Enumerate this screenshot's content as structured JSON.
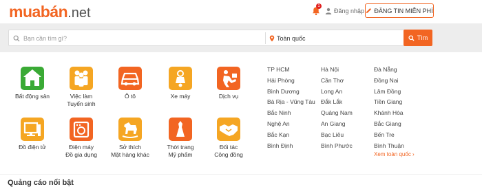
{
  "header": {
    "logo_main": "muabán",
    "logo_suffix": ".net",
    "notification_count": "1",
    "login_label": "Đăng nhập",
    "post_button_label": "ĐĂNG TIN MIỄN PHÍ"
  },
  "search": {
    "placeholder": "Bạn cần tìm gì?",
    "location": "Toàn quốc",
    "button_label": "Tìm"
  },
  "categories": [
    {
      "label": "Bất động sản",
      "icon": "house-icon",
      "color": "#3aaa35"
    },
    {
      "label": "Việc làm\nTuyển sinh",
      "icon": "people-icon",
      "color": "#f5a623"
    },
    {
      "label": "Ô tô",
      "icon": "car-icon",
      "color": "#f26522"
    },
    {
      "label": "Xe máy",
      "icon": "motorbike-icon",
      "color": "#f5a623"
    },
    {
      "label": "Dịch vụ",
      "icon": "service-icon",
      "color": "#f26522"
    },
    {
      "label": "Đồ điện tử",
      "icon": "computer-icon",
      "color": "#f5a623"
    },
    {
      "label": "Điện máy\nĐồ gia dụng",
      "icon": "appliance-icon",
      "color": "#f26522"
    },
    {
      "label": "Sở thích\nMặt hàng khác",
      "icon": "toy-horse-icon",
      "color": "#f5a623"
    },
    {
      "label": "Thời trang\nMỹ phẩm",
      "icon": "fashion-icon",
      "color": "#f26522"
    },
    {
      "label": "Đối tác\nCông đồng",
      "icon": "handshake-icon",
      "color": "#f5a623"
    }
  ],
  "cities": [
    [
      "TP HCM",
      "Hà Nội",
      "Đà Nẵng"
    ],
    [
      "Hải Phòng",
      "Cần Thơ",
      "Đồng Nai"
    ],
    [
      "Bình Dương",
      "Long An",
      "Lâm Đồng"
    ],
    [
      "Bà Rịa - Vũng Tàu",
      "Đắk Lắk",
      "Tiền Giang"
    ],
    [
      "Bắc Ninh",
      "Quảng Nam",
      "Khánh Hòa"
    ],
    [
      "Nghệ An",
      "An Giang",
      "Bắc Giang"
    ],
    [
      "Bắc Kạn",
      "Bạc Liêu",
      "Bến Tre"
    ],
    [
      "Bình Định",
      "Bình Phước",
      "Bình Thuận"
    ]
  ],
  "see_all_label": "Xem toàn quốc ›",
  "section_title": "Quảng cáo nổi bật",
  "colors": {
    "brand": "#f26522",
    "background_band": "#ededed"
  }
}
